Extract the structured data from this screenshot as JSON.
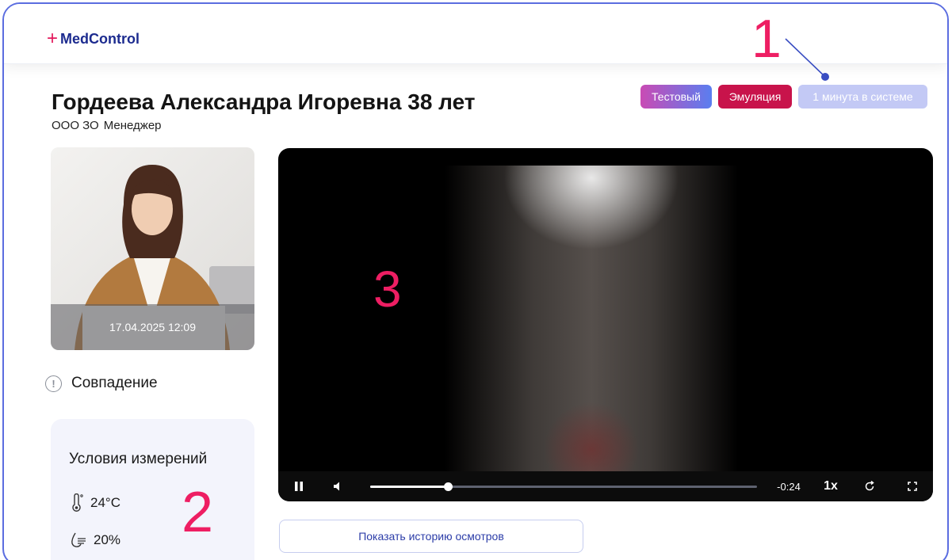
{
  "app": {
    "logo_plus": "+",
    "logo_text": "MedControl"
  },
  "callouts": {
    "c1": "1",
    "c2": "2",
    "c3": "3"
  },
  "patient": {
    "name": "Гордеева Александра Игоревна 38 лет",
    "company": "ООО ЗО",
    "position": "Менеджер"
  },
  "badges": {
    "test": "Тестовый",
    "emulation": "Эмуляция",
    "time_in_system": "1 минута в системе"
  },
  "photo": {
    "timestamp": "17.04.2025 12:09"
  },
  "match": {
    "icon": "info-icon",
    "label": "Совпадение"
  },
  "conditions": {
    "title": "Условия измерений",
    "temperature": "24°C",
    "humidity": "20%"
  },
  "video": {
    "time_remaining": "-0:24",
    "speed": "1x",
    "progress": 0.2
  },
  "history_button": "Показать историю осмотров",
  "colors": {
    "accent": "#1c2b8f",
    "callout": "#ee1e63",
    "emulation": "#c8134b",
    "time_badge": "#c3c9f5"
  }
}
